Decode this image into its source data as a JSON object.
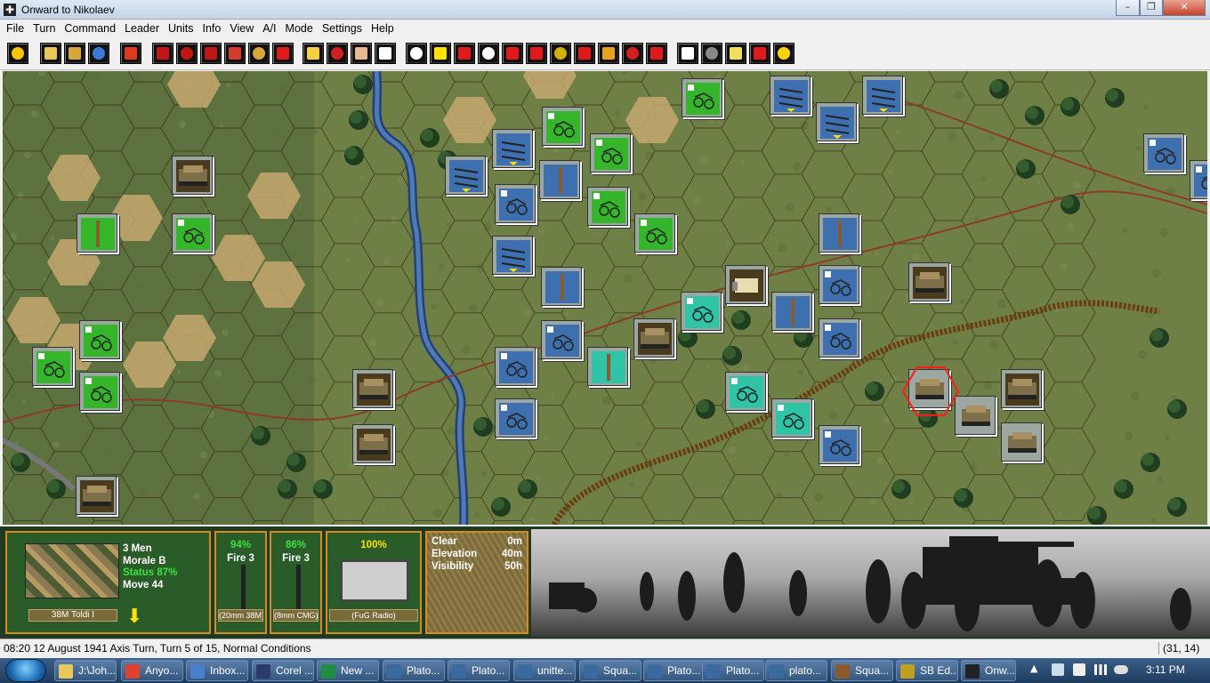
{
  "window": {
    "title": "Onward to Nikolaev",
    "min_label": "–",
    "max_label": "❐",
    "close_label": "✕"
  },
  "menu": [
    "File",
    "Turn",
    "Command",
    "Leader",
    "Units",
    "Info",
    "View",
    "A/I",
    "Mode",
    "Settings",
    "Help"
  ],
  "toolbar_icons": [
    "target-icon",
    "sheet-icon",
    "folder-icon",
    "save-icon",
    "phase-icon",
    "move-icon",
    "fire-icon",
    "assault-icon",
    "rally-icon",
    "ammo-icon",
    "flag-icon",
    "objective-icon",
    "reinforce-icon",
    "leader-icon",
    "zoom-in-icon",
    "zoom-out-icon",
    "hex-icon",
    "counter-icon",
    "star-icon",
    "range-icon",
    "los-icon",
    "mode-icon",
    "medic-icon",
    "arty-icon",
    "air-icon",
    "red-dot-icon",
    "swap-icon",
    "radar-icon",
    "explosion-icon",
    "report-icon",
    "help-icon"
  ],
  "unit_panel": {
    "men": "3 Men",
    "morale": "Morale B",
    "status": "Status 87%",
    "move": "Move 44",
    "name": "38M Toldi I"
  },
  "weapons": [
    {
      "pct": "94%",
      "fire": "Fire 3",
      "name": "(20mm 38M)"
    },
    {
      "pct": "86%",
      "fire": "Fire 3",
      "name": "(8mm CMG)"
    },
    {
      "pct": "100%",
      "fire": "",
      "name": "(FuG Radio)"
    }
  ],
  "terrain": {
    "type_label": "Clear",
    "type_value": "0m",
    "elev_label": "Elevation",
    "elev_value": "40m",
    "vis_label": "Visibility",
    "vis_value": "50h"
  },
  "status": {
    "left": "08:20 12 August 1941 Axis Turn, Turn 5 of 15, Normal Conditions",
    "right": "(31, 14)"
  },
  "taskbar": {
    "items": [
      "J:\\Joh...",
      "Anyo...",
      "Inbox...",
      "Corel ...",
      "New ...",
      "Plato...",
      "Plato...",
      "unitte...",
      "Squa...",
      "Plato...",
      "Plato...",
      "plato...",
      "Squa...",
      "SB Ed...",
      "Onw..."
    ],
    "clock": "3:11 PM"
  },
  "colors": {
    "hex_green": "#34b52a",
    "hex_blue": "#3e6fae",
    "hex_teal": "#2ec4a5",
    "panel_border": "#d58b1f"
  }
}
